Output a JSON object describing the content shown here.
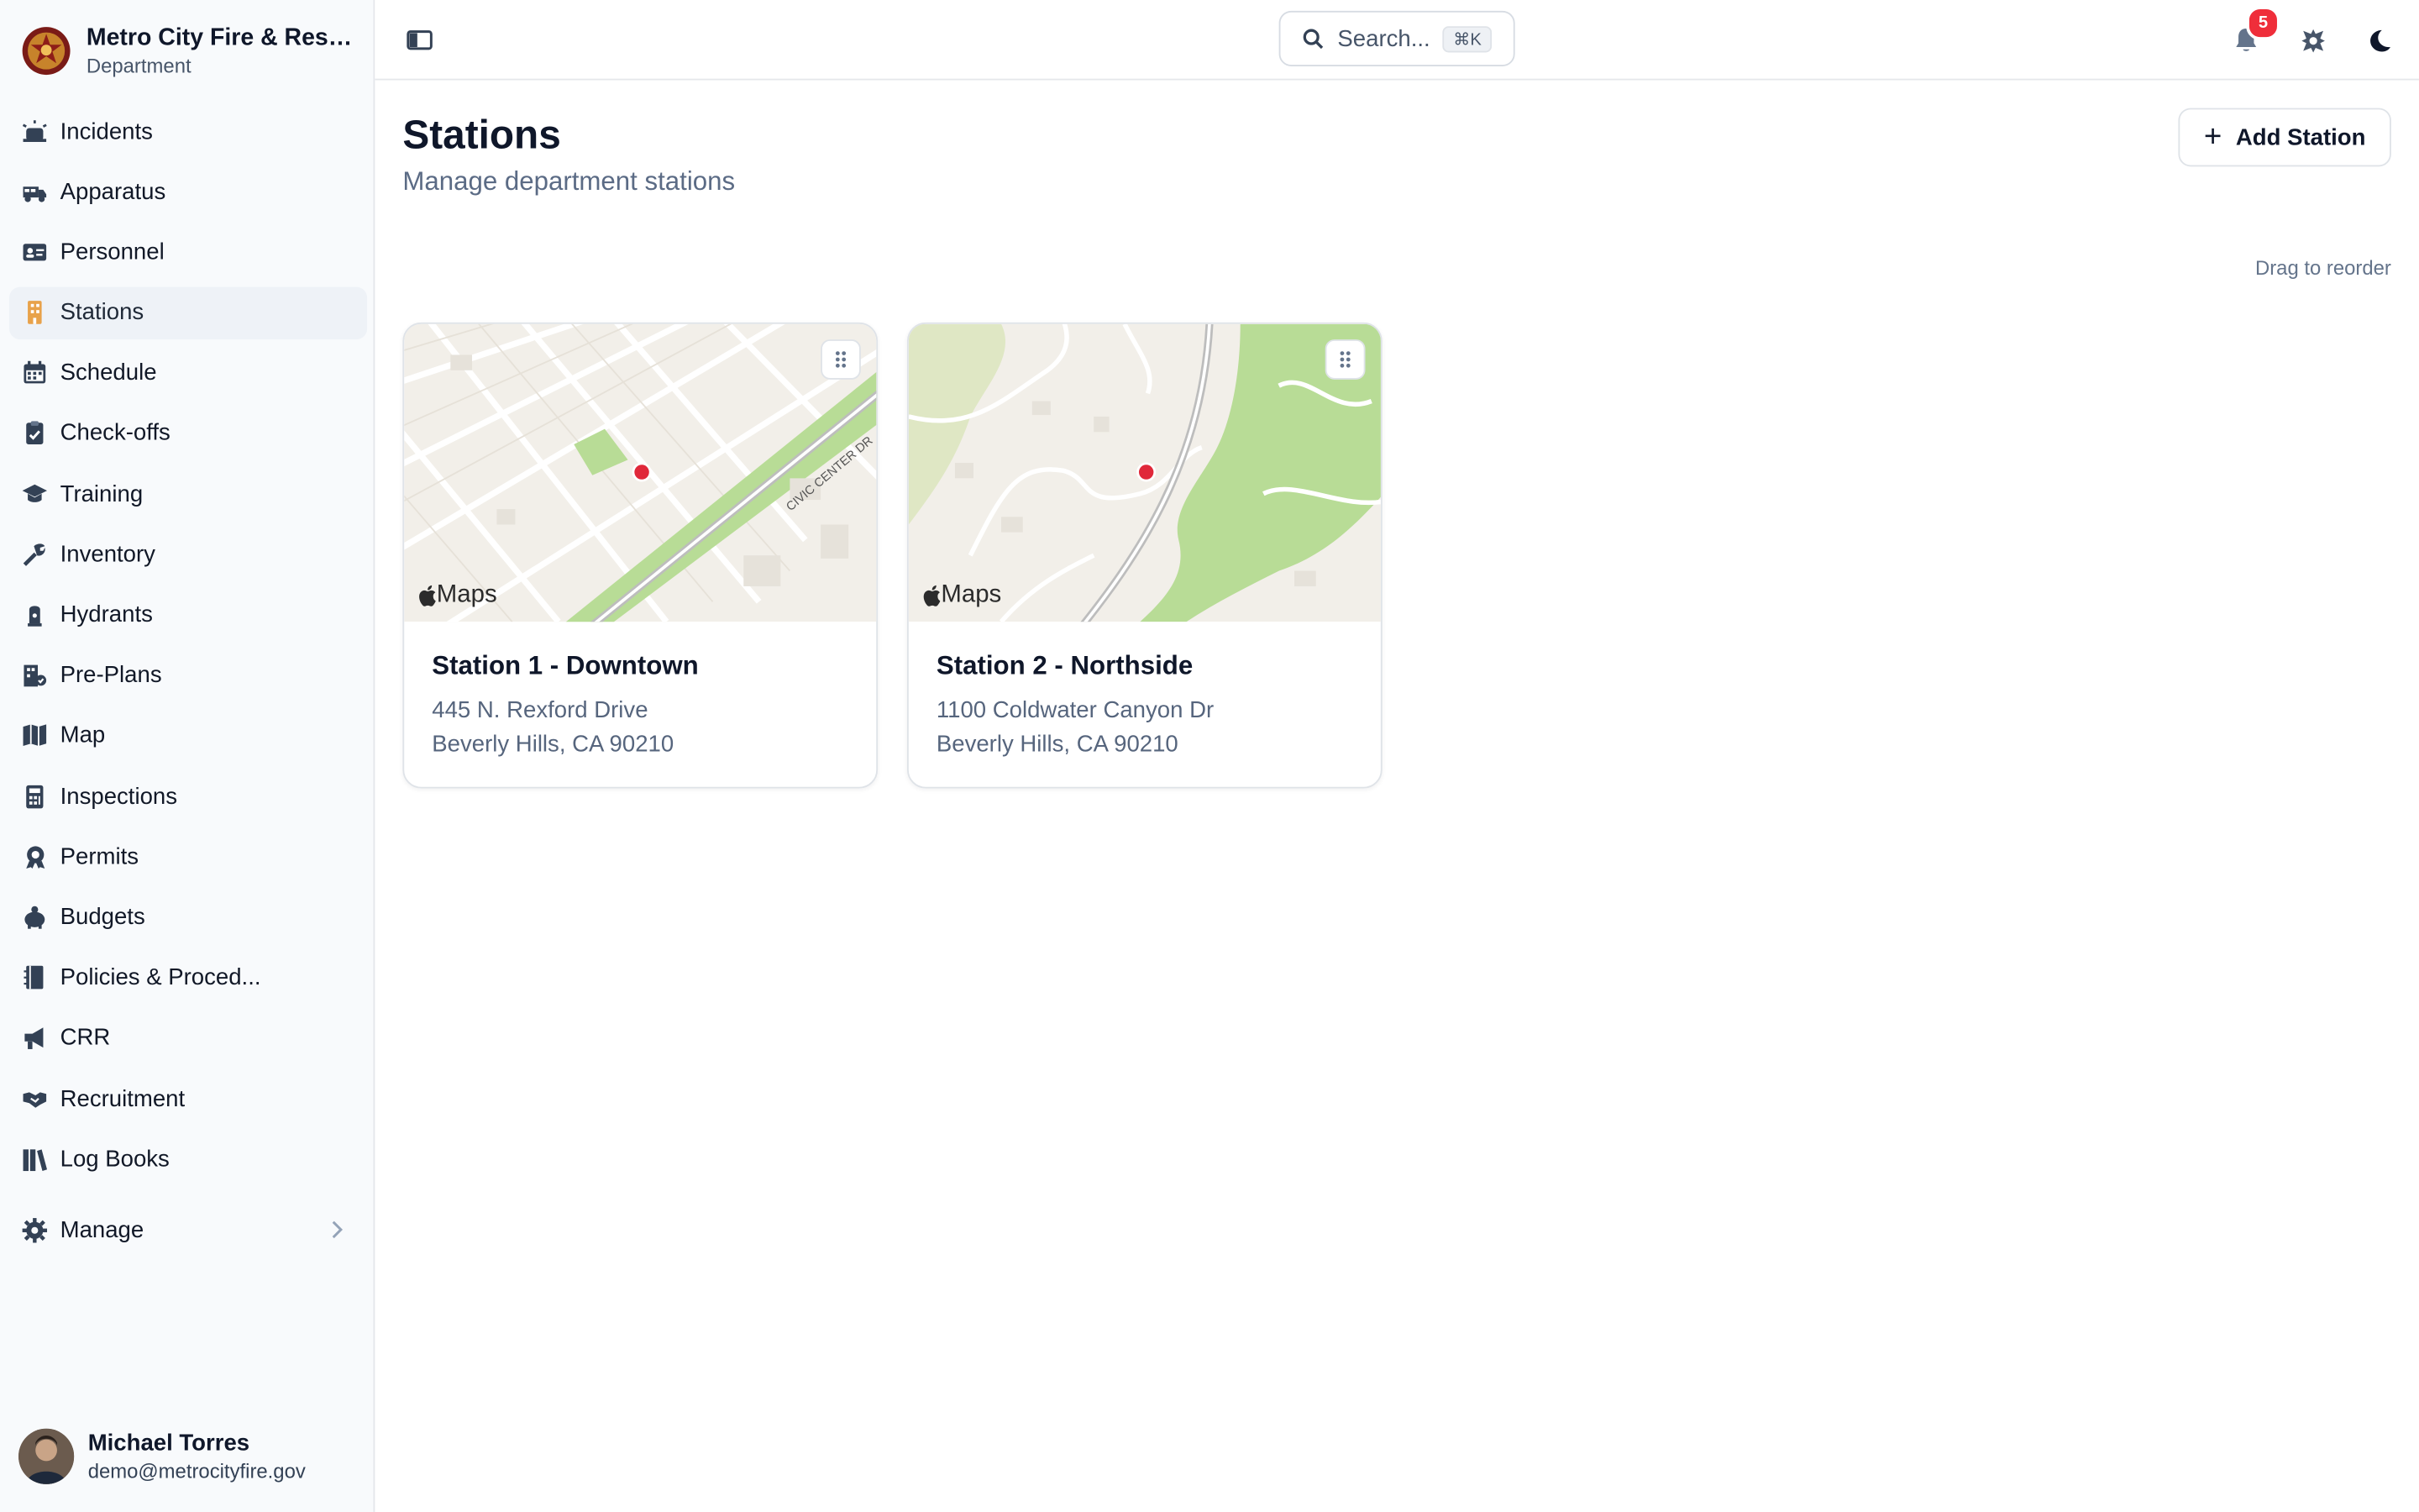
{
  "org": {
    "name": "Metro City Fire & Resc...",
    "sub": "Department"
  },
  "nav": {
    "items": [
      {
        "label": "Incidents",
        "icon": "siren-icon"
      },
      {
        "label": "Apparatus",
        "icon": "fire-truck-icon"
      },
      {
        "label": "Personnel",
        "icon": "id-card-icon"
      },
      {
        "label": "Stations",
        "icon": "building-icon",
        "active": true
      },
      {
        "label": "Schedule",
        "icon": "calendar-icon"
      },
      {
        "label": "Check-offs",
        "icon": "clipboard-check-icon"
      },
      {
        "label": "Training",
        "icon": "graduation-cap-icon"
      },
      {
        "label": "Inventory",
        "icon": "tools-icon"
      },
      {
        "label": "Hydrants",
        "icon": "hydrant-icon"
      },
      {
        "label": "Pre-Plans",
        "icon": "building-plan-icon"
      },
      {
        "label": "Map",
        "icon": "map-icon"
      },
      {
        "label": "Inspections",
        "icon": "calculator-icon"
      },
      {
        "label": "Permits",
        "icon": "permit-badge-icon"
      },
      {
        "label": "Budgets",
        "icon": "piggy-bank-icon"
      },
      {
        "label": "Policies & Proced...",
        "icon": "book-icon"
      },
      {
        "label": "CRR",
        "icon": "megaphone-icon"
      },
      {
        "label": "Recruitment",
        "icon": "handshake-icon"
      },
      {
        "label": "Log Books",
        "icon": "books-icon"
      }
    ],
    "manage": {
      "label": "Manage",
      "icon": "gear-icon"
    }
  },
  "user": {
    "name": "Michael Torres",
    "email": "demo@metrocityfire.gov"
  },
  "topbar": {
    "search_placeholder": "Search...",
    "search_shortcut": "⌘K",
    "notifications_count": "5"
  },
  "page": {
    "title": "Stations",
    "subtitle": "Manage department stations",
    "add_button": "Add Station",
    "drag_hint": "Drag to reorder"
  },
  "stations": [
    {
      "name": "Station 1 - Downtown",
      "address1": "445 N. Rexford Drive",
      "address2": "Beverly Hills, CA 90210",
      "map_label": "Maps",
      "street_label": "CIVIC CENTER DR"
    },
    {
      "name": "Station 2 - Northside",
      "address1": "1100 Coldwater Canyon Dr",
      "address2": "Beverly Hills, CA 90210",
      "map_label": "Maps"
    }
  ],
  "colors": {
    "accent": "#ef2e3a",
    "pin": "#e0283a",
    "active_bg": "#eef2f7",
    "map_bg": "#f2efe9",
    "park": "#b8dc96"
  }
}
